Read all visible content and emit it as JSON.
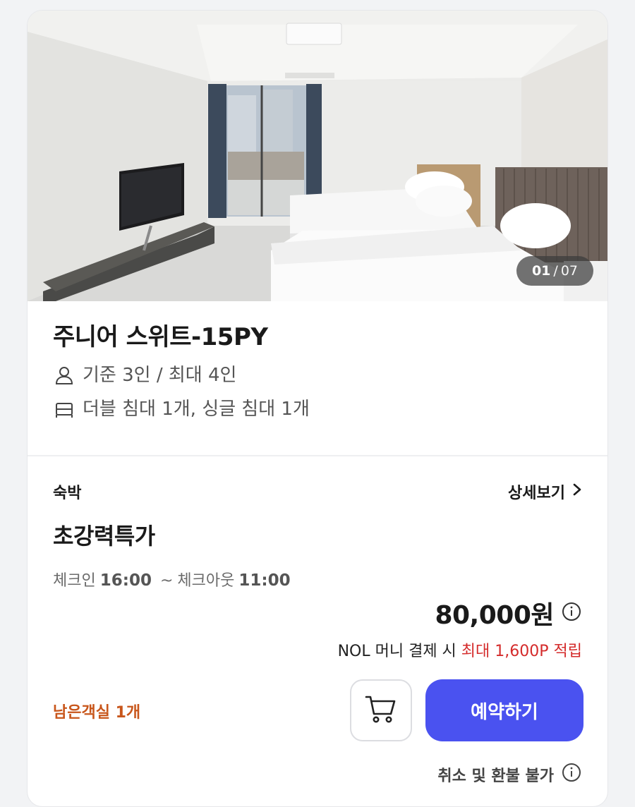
{
  "photo": {
    "current": "01",
    "separator": "/",
    "total": "07"
  },
  "room": {
    "title": "주니어 스위트-15PY",
    "capacity": "기준 3인 / 최대 4인",
    "beds": "더블 침대 1개, 싱글 침대 1개",
    "icons": [
      "person-icon",
      "bed-icon"
    ]
  },
  "offer": {
    "stay_type": "숙박",
    "detail_label": "상세보기",
    "name": "초강력특가",
    "checkin_label": "체크인",
    "checkin_time": "16:00",
    "tilde": "~",
    "checkout_label": "체크아웃",
    "checkout_time": "11:00",
    "price": "80,000원",
    "point_prefix": "NOL 머니 결제 시",
    "point_highlight": "최대 1,600P 적립",
    "remaining": "남은객실 1개",
    "book_label": "예약하기",
    "refund_policy": "취소 및 환불 불가"
  },
  "colors": {
    "accent": "#4a52f0",
    "point_highlight": "#d42b2b",
    "remaining": "#c8561b"
  }
}
